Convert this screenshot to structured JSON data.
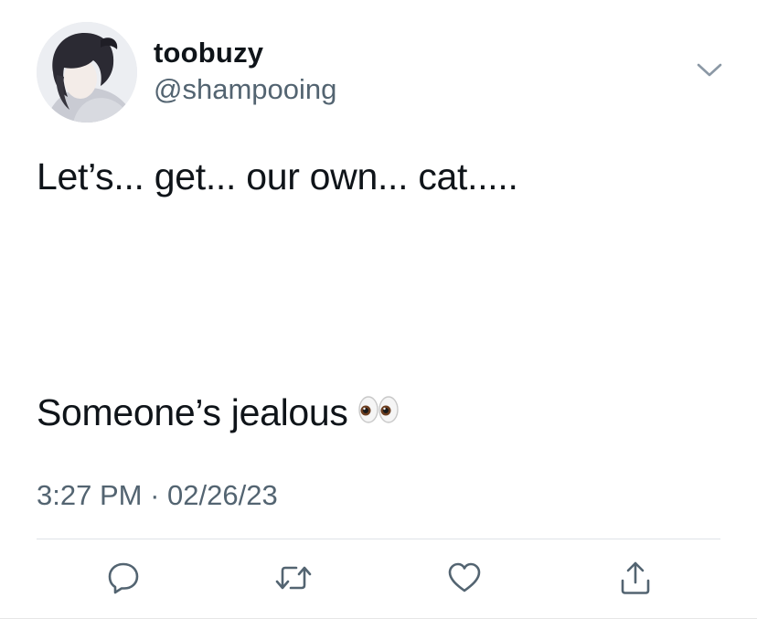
{
  "user": {
    "display_name": "toobuzy",
    "handle": "@shampooing",
    "avatar_icon": "profile-photo"
  },
  "tweet": {
    "line1": "Let’s... get... our own... cat.....",
    "line2": "Someone’s jealous",
    "emoji": "eyes-emoji",
    "time": "3:27 PM",
    "separator": "·",
    "date": "02/26/23"
  },
  "menu_icon": "chevron-down-icon",
  "actions": [
    "reply-icon",
    "retweet-icon",
    "like-icon",
    "share-icon"
  ],
  "colors": {
    "text": "#0f1419",
    "secondary": "#536471",
    "divider": "#dfe3e7"
  }
}
